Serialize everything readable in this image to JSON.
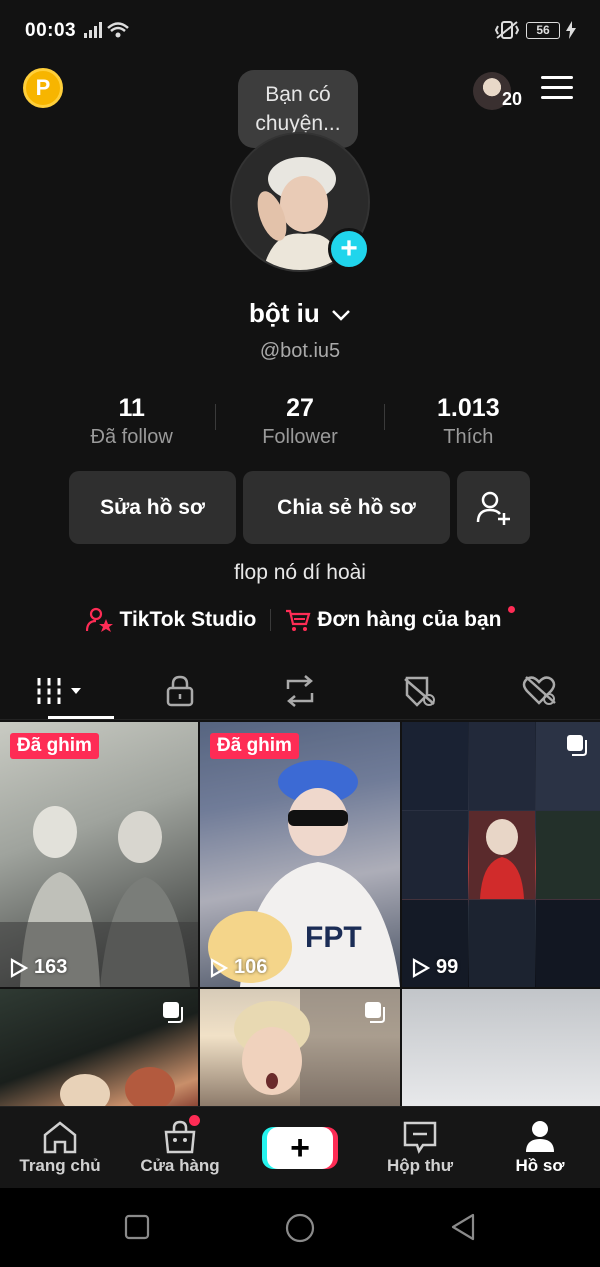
{
  "status_bar": {
    "time": "00:03",
    "battery": "56"
  },
  "header": {
    "coin_label": "P",
    "notification_count": "20"
  },
  "profile": {
    "note": "Bạn có chuyện...",
    "display_name": "bột iu",
    "username": "@bot.iu5",
    "stats": [
      {
        "value": "11",
        "label": "Đã follow"
      },
      {
        "value": "27",
        "label": "Follower"
      },
      {
        "value": "1.013",
        "label": "Thích"
      }
    ],
    "buttons": {
      "edit": "Sửa hồ sơ",
      "share": "Chia sẻ hồ sơ"
    },
    "bio": "flop nó dí hoài",
    "links": {
      "studio": "TikTok Studio",
      "orders": "Đơn hàng của bạn"
    }
  },
  "tabs": [
    "videos-grid-icon",
    "lock-icon",
    "repost-icon",
    "tagged-icon",
    "liked-icon"
  ],
  "videos": [
    {
      "pinned": "Đã ghim",
      "views": "163"
    },
    {
      "pinned": "Đã ghim",
      "views": "106"
    },
    {
      "pinned": "",
      "views": "99"
    },
    {
      "pinned": "",
      "views": ""
    },
    {
      "pinned": "",
      "views": ""
    },
    {
      "pinned": "",
      "views": ""
    }
  ],
  "bottom_nav": [
    {
      "label": "Trang chủ"
    },
    {
      "label": "Cửa hàng"
    },
    {
      "label": "+"
    },
    {
      "label": "Hộp thư"
    },
    {
      "label": "Hồ sơ"
    }
  ],
  "colors": {
    "accent_pink": "#fe2c55",
    "accent_cyan": "#25f4ee",
    "background": "#121212"
  }
}
